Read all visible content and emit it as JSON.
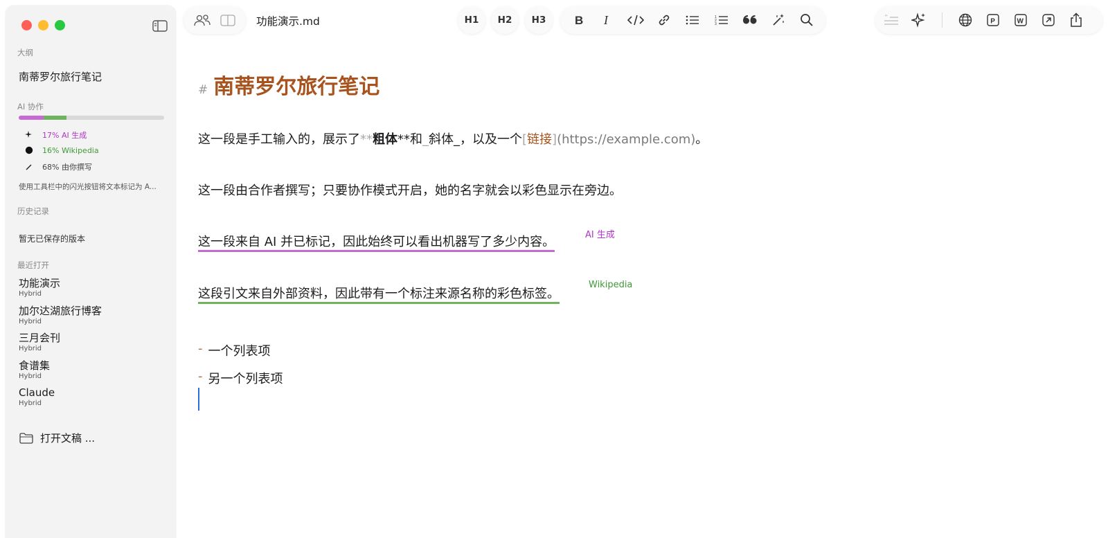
{
  "sidebar": {
    "outline_label": "大纲",
    "outline_items": [
      "南蒂罗尔旅行笔记"
    ],
    "ai_label": "AI 协作",
    "ai_stats": [
      {
        "label": "17% AI 生成",
        "color": "#b233c8",
        "icon": "sparkle-icon",
        "percent": 17
      },
      {
        "label": "16% Wikipedia",
        "color": "#3f9a36",
        "icon": "circle-icon",
        "percent": 16
      },
      {
        "label": "68% 由你撰写",
        "color": "#444444",
        "icon": "pencil-icon",
        "percent": 68
      }
    ],
    "hint": "使用工具栏中的闪光按钮将文本标记为 A...",
    "history_label": "历史记录",
    "history_empty": "暂无已保存的版本",
    "recent_label": "最近打开",
    "recent_items": [
      {
        "title": "功能演示",
        "subtitle": "Hybrid"
      },
      {
        "title": "加尔达湖旅行博客",
        "subtitle": "Hybrid"
      },
      {
        "title": "三月会刊",
        "subtitle": "Hybrid"
      },
      {
        "title": "食谱集",
        "subtitle": "Hybrid"
      },
      {
        "title": "Claude",
        "subtitle": "Hybrid"
      }
    ],
    "open_draft": "打开文稿 ..."
  },
  "toolbar": {
    "doc_title": "功能演示.md",
    "headings": [
      "H1",
      "H2",
      "H3"
    ]
  },
  "editor": {
    "heading_marker": "#",
    "heading": "南蒂罗尔旅行笔记",
    "p1": {
      "a": "这一段是手工输入的，展示了",
      "bold_open": "**",
      "bold": "粗体",
      "bold_close": "**和",
      "ital_open": "_",
      "italic": "斜体",
      "ital_close": "_，以及一个",
      "lb": "[",
      "link": "链接",
      "rb": "]",
      "url": "(https://example.com)",
      "end": "。"
    },
    "p2": "这一段由合作者撰写；只要协作模式开启，她的名字就会以彩色显示在旁边。",
    "p3": "这一段来自 AI 并已标记，因此始终可以看出机器写了多少内容。",
    "p3_tag": "AI 生成",
    "p4": "这段引文来自外部资料，因此带有一个标注来源名称的彩色标签。",
    "p4_tag": "Wikipedia",
    "list_marker": "-",
    "list": [
      "一个列表项",
      "另一个列表项"
    ]
  },
  "colors": {
    "accent": "#a8531d",
    "ai": "#c86ad6",
    "wikipedia": "#6fb35e",
    "caret": "#2a6fd6"
  }
}
